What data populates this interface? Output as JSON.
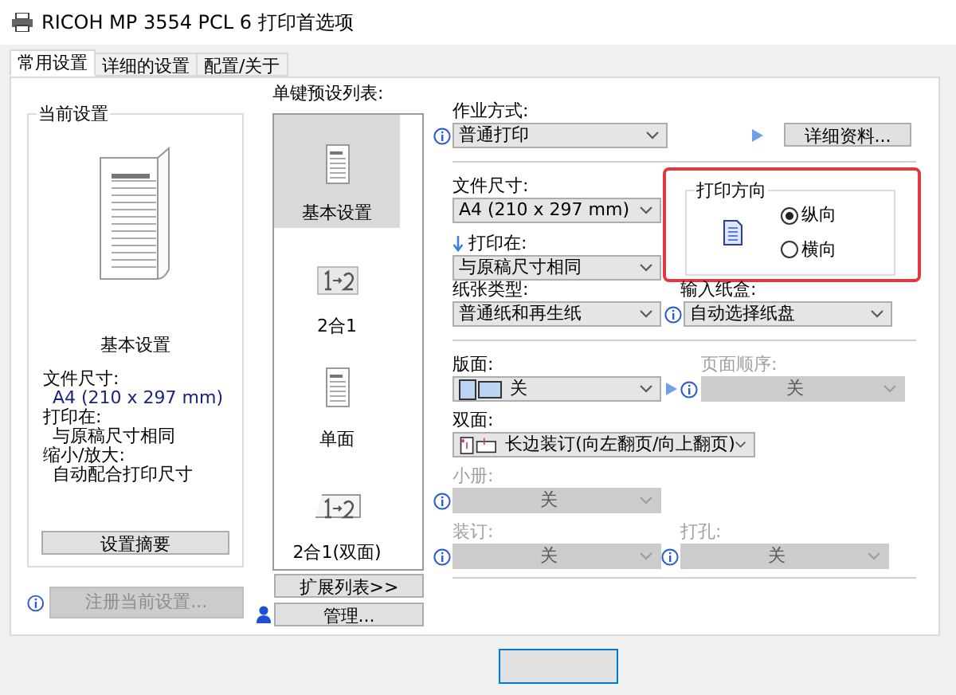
{
  "window": {
    "title": "RICOH MP 3554 PCL 6 打印首选项"
  },
  "tabs": [
    {
      "label": "常用设置",
      "selected": true
    },
    {
      "label": "详细的设置",
      "selected": false
    },
    {
      "label": "配置/关于",
      "selected": false
    }
  ],
  "current_settings": {
    "title": "当前设置",
    "preset_name": "基本设置",
    "details": [
      {
        "label": "文件尺寸:",
        "value": "A4 (210 x 297 mm)"
      },
      {
        "label": "打印在:",
        "value": "与原稿尺寸相同"
      },
      {
        "label": "缩小/放大:",
        "value": "自动配合打印尺寸"
      }
    ],
    "summary_button": "设置摘要"
  },
  "register_button": {
    "label": "注册当前设置...",
    "disabled": true
  },
  "presets": {
    "title": "单键预设列表:",
    "items": [
      {
        "label": "基本设置",
        "kind": "page",
        "selected": true
      },
      {
        "label": "2合1",
        "kind": "two_up",
        "selected": false
      },
      {
        "label": "单面",
        "kind": "page",
        "selected": false
      },
      {
        "label": "2合1(双面)",
        "kind": "two_up_duplex",
        "selected": false
      }
    ]
  },
  "expand_button": "扩展列表>>",
  "manage_button": "管理...",
  "job_type": {
    "label": "作业方式:",
    "value": "普通打印"
  },
  "details_button": "详细资料...",
  "paper_size": {
    "label": "文件尺寸:",
    "value": "A4 (210 x 297 mm)"
  },
  "print_on": {
    "label": "打印在:",
    "value": "与原稿尺寸相同"
  },
  "orientation": {
    "title": "打印方向",
    "highlighted": true,
    "options": [
      {
        "label": "纵向",
        "selected": true
      },
      {
        "label": "横向",
        "selected": false
      }
    ]
  },
  "paper_type": {
    "label": "纸张类型:",
    "value": "普通纸和再生纸"
  },
  "input_tray": {
    "label": "输入纸盒:",
    "value": "自动选择纸盘"
  },
  "layout": {
    "label": "版面:",
    "value": "关"
  },
  "page_order": {
    "label": "页面顺序:",
    "value": "关",
    "disabled": true
  },
  "duplex": {
    "label": "双面:",
    "value": "长边装订(向左翻页/向上翻页)"
  },
  "booklet": {
    "label": "小册:",
    "value": "关",
    "disabled": true
  },
  "staple": {
    "label": "装订:",
    "value": "关",
    "disabled": true
  },
  "punch": {
    "label": "打孔:",
    "value": "关",
    "disabled": true
  }
}
